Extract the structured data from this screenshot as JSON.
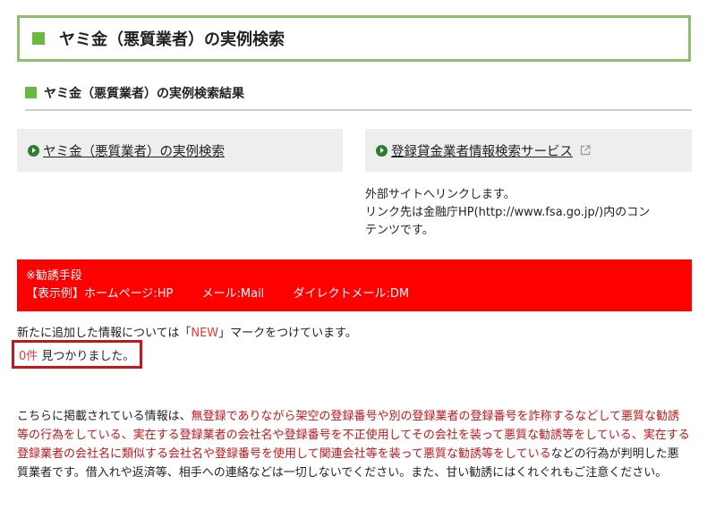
{
  "page": {
    "title": "ヤミ金（悪質業者）の実例検索",
    "subtitle": "ヤミ金（悪質業者）の実例検索結果"
  },
  "links": {
    "left": {
      "label": "ヤミ金（悪質業者）の実例検索",
      "icon": "circle-arrow-icon"
    },
    "right": {
      "label": "登録貸金業者情報検索サービス",
      "icon": "external-link-icon"
    }
  },
  "external_note": {
    "line1": "外部サイトへリンクします。",
    "line2": "リンク先は金融庁HP(http://www.fsa.go.jp/)内のコン",
    "line3": "テンツです。"
  },
  "solicitation": {
    "heading": "※勧誘手段",
    "example_label": "【表示例】ホームページ:HP",
    "mail": "メール:Mail",
    "direct_mail": "ダイレクトメール:DM"
  },
  "new_notice": {
    "before": "新たに追加した情報については「",
    "mark": "NEW",
    "after": "」マークをつけています。"
  },
  "result": {
    "count": "0件",
    "text": "見つかりました。"
  },
  "warning": {
    "prefix": "こちらに掲載されている情報は、",
    "red": "無登録でありながら架空の登録番号や別の登録業者の登録番号を詐称するなどして悪質な勧誘等の行為をしている、実在する登録業者の会社名や登録番号を不正使用してその会社を装って悪質な勧誘等をしている、実在する登録業者の会社名に類似する会社名や登録番号を使用して関連会社等を装って悪質な勧誘等をしている",
    "suffix": "などの行為が判明した悪質業者です。借入れや返済等、相手への連絡などは一切しないでください。また、甘い勧誘にはくれぐれもご注意ください。"
  },
  "colors": {
    "accent_green": "#6bb843",
    "border_green": "#8dc06b",
    "alert_red": "#ff0000",
    "text_red": "#c4161c"
  }
}
